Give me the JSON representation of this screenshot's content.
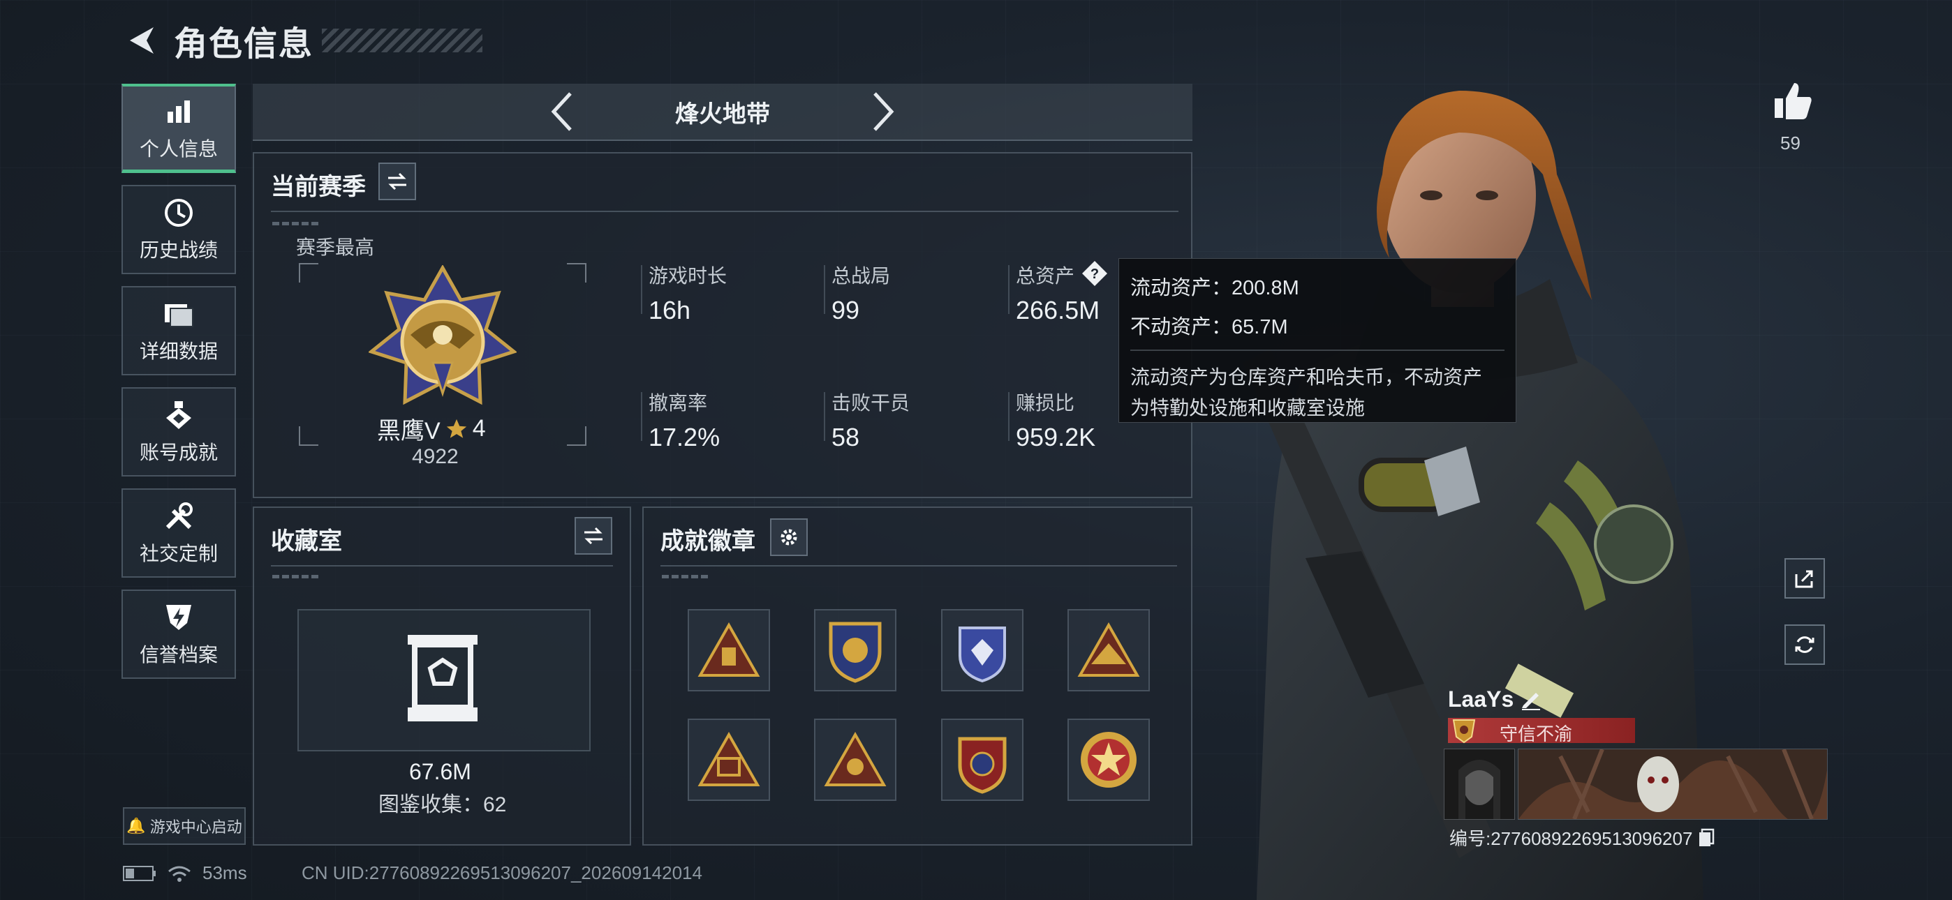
{
  "header": {
    "title": "角色信息"
  },
  "sidebar": {
    "items": [
      {
        "label": "个人信息",
        "icon": "bar-chart-icon",
        "active": true
      },
      {
        "label": "历史战绩",
        "icon": "history-clock-icon"
      },
      {
        "label": "详细数据",
        "icon": "folder-icon"
      },
      {
        "label": "账号成就",
        "icon": "medal-icon"
      },
      {
        "label": "社交定制",
        "icon": "tools-icon"
      },
      {
        "label": "信誉档案",
        "icon": "shield-bolt-icon"
      }
    ],
    "game_center": "游戏中心启动"
  },
  "mode": {
    "title": "烽火地带"
  },
  "season": {
    "title": "当前赛季",
    "best_label": "赛季最高",
    "rank_name": "黑鹰V",
    "rank_stars": "4",
    "rank_score": "4922",
    "stats": [
      {
        "label": "游戏时长",
        "value": "16h"
      },
      {
        "label": "总战局",
        "value": "99"
      },
      {
        "label": "总资产",
        "value": "266.5M"
      },
      {
        "label": "撤离率",
        "value": "17.2%"
      },
      {
        "label": "击败干员",
        "value": "58"
      },
      {
        "label": "赚损比",
        "value": "959.2K"
      }
    ]
  },
  "tooltip": {
    "liquid": "流动资产：200.8M",
    "fixed": "不动资产：65.7M",
    "note_line1": "流动资产为仓库资产和哈夫币，不动资产",
    "note_line2": "为特勤处设施和收藏室设施"
  },
  "vault": {
    "title": "收藏室",
    "value": "67.6M",
    "collection": "图鉴收集：62"
  },
  "badges": {
    "title": "成就徽章"
  },
  "likes": {
    "count": "59"
  },
  "player": {
    "name": "LaaYs",
    "title": "守信不渝",
    "id": "编号:27760892269513096207"
  },
  "status": {
    "ping": "53ms",
    "uid": "CN UID:27760892269513096207_202609142014"
  },
  "colors": {
    "accent": "#4fc08d",
    "title_red": "#b03a3a",
    "gold": "#d4a640"
  }
}
